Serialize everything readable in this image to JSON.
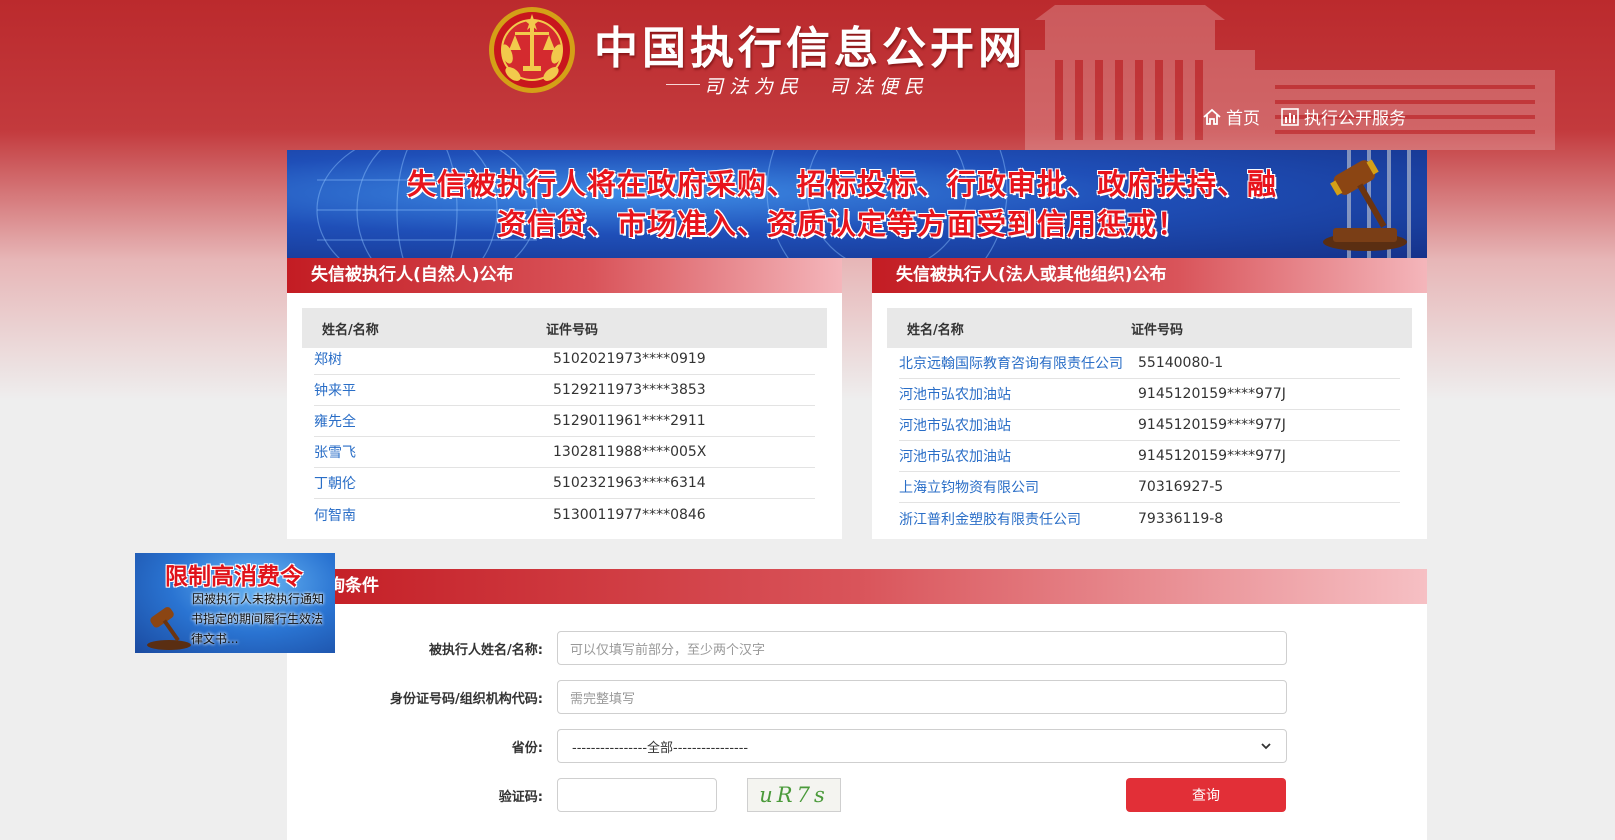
{
  "header": {
    "site_title": "中国执行信息公开网",
    "slogan": "司法为民　司法便民",
    "nav": [
      {
        "label": "首页",
        "icon": "home-icon"
      },
      {
        "label": "执行公开服务",
        "icon": "bar-chart-icon"
      }
    ]
  },
  "banner": {
    "line1": "失信被执行人将在政府采购、招标投标、行政审批、政府扶持、融",
    "line2": "资信贷、市场准入、资质认定等方面受到信用惩戒！"
  },
  "natural_panel": {
    "title": "失信被执行人(自然人)公布",
    "col_name": "姓名/名称",
    "col_id": "证件号码",
    "rows": [
      {
        "name": "郑树",
        "id": "5102021973****0919"
      },
      {
        "name": "钟来平",
        "id": "5129211973****3853"
      },
      {
        "name": "雍先全",
        "id": "5129011961****2911"
      },
      {
        "name": "张雪飞",
        "id": "1302811988****005X"
      },
      {
        "name": "丁朝伦",
        "id": "5102321963****6314"
      },
      {
        "name": "何智南",
        "id": "5130011977****0846"
      }
    ]
  },
  "org_panel": {
    "title": "失信被执行人(法人或其他组织)公布",
    "col_name": "姓名/名称",
    "col_id": "证件号码",
    "rows": [
      {
        "name": "北京远翰国际教育咨询有限责任公司",
        "id": "55140080-1"
      },
      {
        "name": "河池市弘农加油站",
        "id": "9145120159****977J"
      },
      {
        "name": "河池市弘农加油站",
        "id": "9145120159****977J"
      },
      {
        "name": "河池市弘农加油站",
        "id": "9145120159****977J"
      },
      {
        "name": "上海立钧物资有限公司",
        "id": "70316927-5"
      },
      {
        "name": "浙江普利金塑胶有限责任公司",
        "id": "79336119-8"
      }
    ]
  },
  "query": {
    "title": "查询条件",
    "name_label": "被执行人姓名/名称:",
    "name_placeholder": "可以仅填写前部分，至少两个汉字",
    "id_label": "身份证号码/组织机构代码:",
    "id_placeholder": "需完整填写",
    "province_label": "省份:",
    "province_value": "----------------全部----------------",
    "captcha_label": "验证码:",
    "captcha_text": "uR7s",
    "submit_label": "查询"
  },
  "float_ad": {
    "title": "限制高消费令",
    "text": "因被执行人未按执行通知书指定的期间履行生效法律文书..."
  },
  "colors": {
    "brand_red": "#c31c23",
    "link_blue": "#2a6ec7",
    "button_red": "#e22f37"
  }
}
